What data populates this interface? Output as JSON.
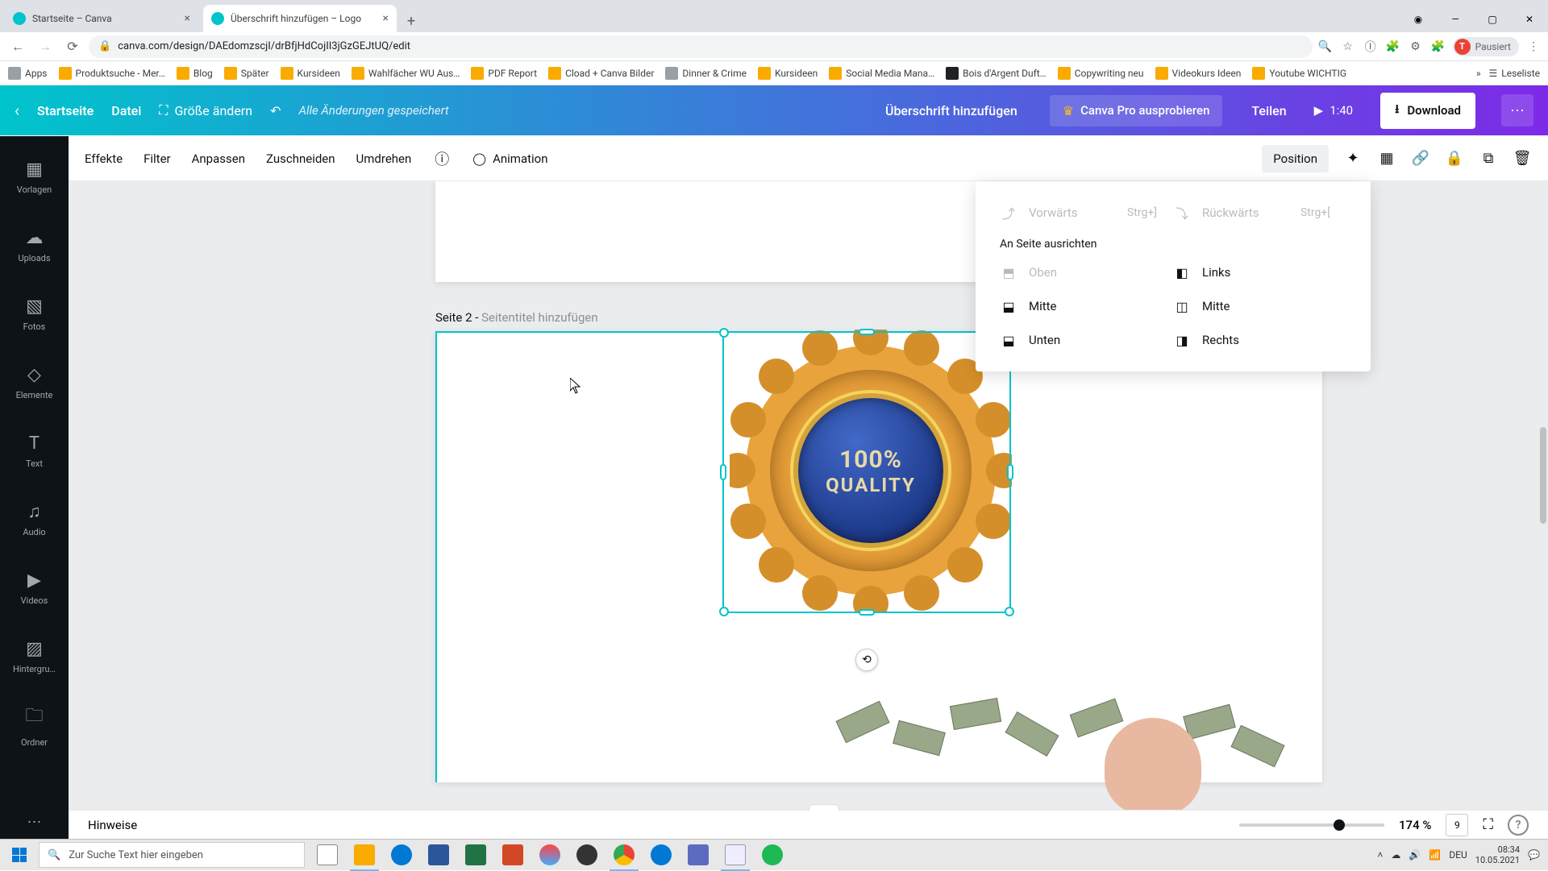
{
  "browser": {
    "tabs": [
      {
        "title": "Startseite – Canva",
        "active": false
      },
      {
        "title": "Überschrift hinzufügen – Logo",
        "active": true
      }
    ],
    "url": "canva.com/design/DAEdomzscjI/drBfjHdCojII3jGzGEJtUQ/edit",
    "profile_status": "Pausiert",
    "profile_initial": "T",
    "bookmarks": [
      "Apps",
      "Produktsuche - Mer…",
      "Blog",
      "Später",
      "Kursideen",
      "Wahlfächer WU Aus…",
      "PDF Report",
      "Cload + Canva Bilder",
      "Dinner & Crime",
      "Kursideen",
      "Social Media Mana…",
      "Bois d'Argent Duft…",
      "Copywriting neu",
      "Videokurs Ideen",
      "Youtube WICHTIG"
    ],
    "reading_list": "Leseliste"
  },
  "header": {
    "home": "Startseite",
    "file": "Datei",
    "resize": "Größe ändern",
    "saved": "Alle Änderungen gespeichert",
    "title": "Überschrift hinzufügen",
    "pro": "Canva Pro ausprobieren",
    "share": "Teilen",
    "play_time": "1:40",
    "download": "Download"
  },
  "rail": {
    "items": [
      "Vorlagen",
      "Uploads",
      "Fotos",
      "Elemente",
      "Text",
      "Audio",
      "Videos",
      "Hintergru…",
      "Ordner"
    ]
  },
  "toolbar": {
    "effects": "Effekte",
    "filter": "Filter",
    "adjust": "Anpassen",
    "crop": "Zuschneiden",
    "flip": "Umdrehen",
    "animation": "Animation",
    "position": "Position"
  },
  "canvas": {
    "page_prefix": "Seite 2",
    "page_action": "Seitentitel hinzufügen",
    "badge_line1": "100%",
    "badge_line2": "QUALITY"
  },
  "dropdown": {
    "forward": "Vorwärts",
    "forward_key": "Strg+]",
    "backward": "Rückwärts",
    "backward_key": "Strg+[",
    "section": "An Seite ausrichten",
    "top": "Oben",
    "left": "Links",
    "middle_v": "Mitte",
    "middle_h": "Mitte",
    "bottom": "Unten",
    "right": "Rechts"
  },
  "footer": {
    "hints": "Hinweise",
    "zoom": "174 %",
    "page_indicator": "9"
  },
  "taskbar": {
    "search_placeholder": "Zur Suche Text hier eingeben",
    "lang": "DEU",
    "time": "08:34",
    "date": "10.05.2021"
  }
}
